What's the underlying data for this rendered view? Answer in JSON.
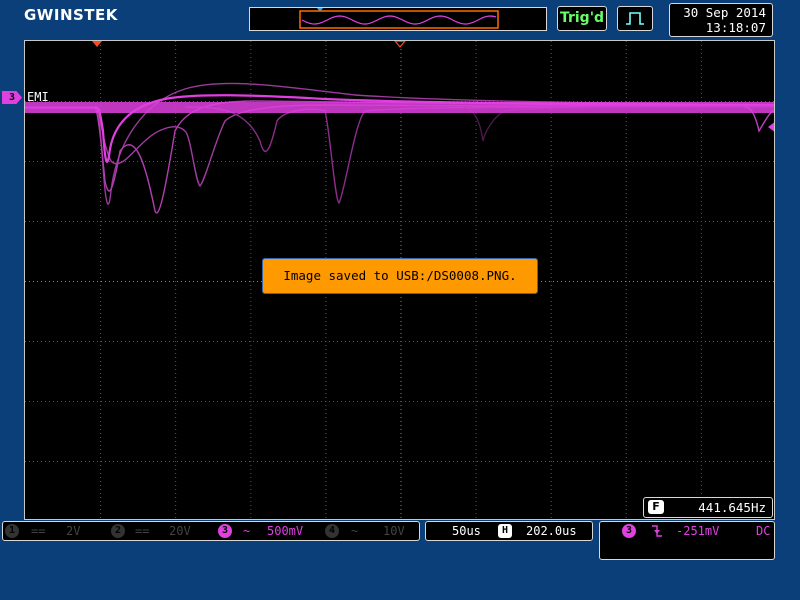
{
  "brand": "GWINSTEK",
  "status_bar": {
    "trigger_status": "Trig'd",
    "date": "30 Sep 2014",
    "time": "13:18:07"
  },
  "waveform": {
    "channel_number": "3",
    "channel_label": "EMI",
    "color": "#e040e0"
  },
  "message": "Image saved to USB:/DS0008.PNG.",
  "frequency": {
    "icon": "F",
    "value": "441.645Hz"
  },
  "channels": [
    {
      "number": "1",
      "coupling": "==",
      "scale": "2V",
      "active": false
    },
    {
      "number": "2",
      "coupling": "==",
      "scale": "20V",
      "active": false
    },
    {
      "number": "3",
      "coupling": "~",
      "scale": "500mV",
      "active": true
    },
    {
      "number": "4",
      "coupling": "~",
      "scale": "10V",
      "active": false
    }
  ],
  "timebase": {
    "scale": "50us",
    "position_icon": "H",
    "position": "202.0us"
  },
  "trigger": {
    "source": "3",
    "slope": "falling-edge-icon",
    "level": "-251mV",
    "coupling": "DC"
  },
  "colors": {
    "background": "#0b3f7a",
    "screen": "#000000",
    "channel3": "#e040e0",
    "trigd": "#66ff66",
    "message_bg": "#ff9900"
  }
}
